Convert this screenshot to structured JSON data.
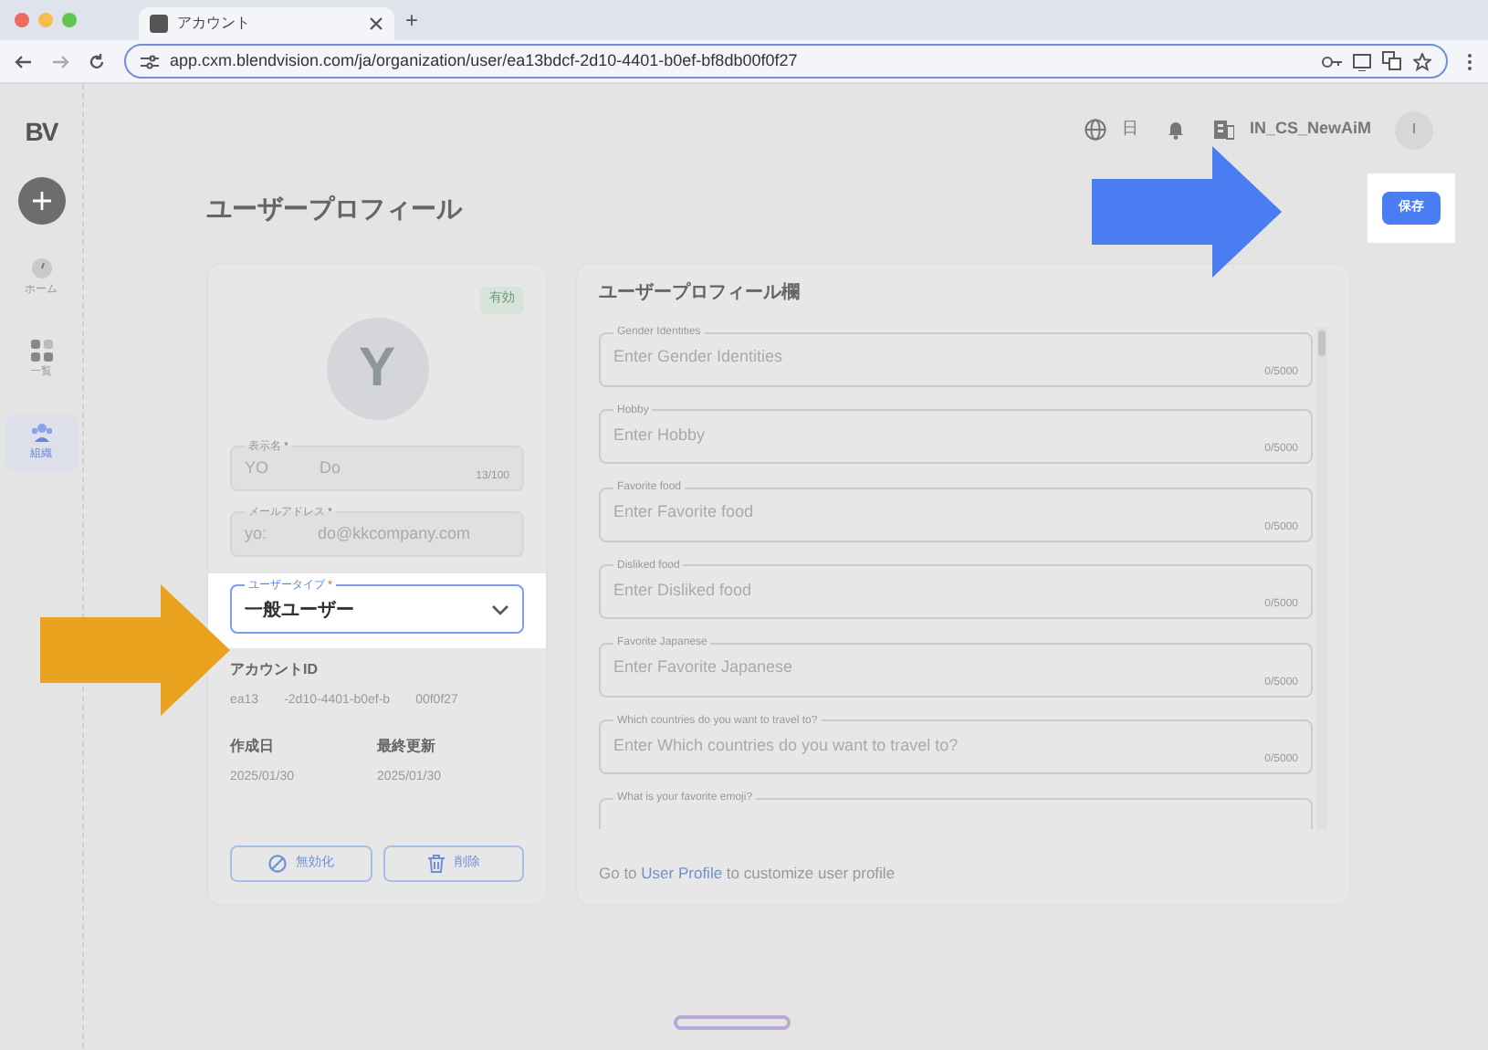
{
  "browser": {
    "tab_title": "アカウント",
    "new_tab": "+",
    "url": "app.cxm.blendvision.com/ja/organization/user/ea13bdcf-2d10-4401-b0ef-bf8db00f0f27"
  },
  "sidebar": {
    "logo": "BV",
    "items": [
      {
        "label": "ホーム",
        "kind": "home",
        "selected": false
      },
      {
        "label": "一覧",
        "kind": "grid",
        "selected": false
      },
      {
        "label": "組織",
        "kind": "people",
        "selected": true
      }
    ]
  },
  "header": {
    "language": "日",
    "organization": "IN_CS_NewAiM",
    "avatar": "I"
  },
  "page": {
    "title": "ユーザープロフィール",
    "save_button": "保存"
  },
  "profile_card": {
    "status": "有効",
    "avatar": "Y",
    "fields": [
      {
        "label": "表示名",
        "required_mark": "*",
        "value": [
          "YO",
          "Do"
        ],
        "counter": "13/100",
        "disabled": true
      },
      {
        "label": "メールアドレス",
        "required_mark": "*",
        "value": [
          "yo:",
          "do@kkcompany.com"
        ],
        "disabled": true
      }
    ],
    "user_type": {
      "label": "ユーザータイプ",
      "required_mark": "*",
      "value": "一般ユーザー"
    },
    "account_id": {
      "label": "アカウントID",
      "value": [
        "ea13",
        "-2d10-4401-b0ef-b",
        "00f0f27"
      ]
    },
    "dates": [
      {
        "label": "作成日",
        "value": "2025/01/30"
      },
      {
        "label": "最終更新",
        "value": "2025/01/30"
      }
    ],
    "buttons": [
      {
        "label": "無効化",
        "kind": "disable"
      },
      {
        "label": "削除",
        "kind": "delete"
      }
    ]
  },
  "profile_fields_card": {
    "title": "ユーザープロフィール欄",
    "fields": [
      {
        "label": "Gender Identities",
        "placeholder": "Enter Gender Identities",
        "counter": "0/5000"
      },
      {
        "label": "Hobby",
        "placeholder": "Enter Hobby",
        "counter": "0/5000"
      },
      {
        "label": "Favorite food",
        "placeholder": "Enter Favorite food",
        "counter": "0/5000"
      },
      {
        "label": "Disliked food",
        "placeholder": "Enter Disliked food",
        "counter": "0/5000"
      },
      {
        "label": "Favorite Japanese",
        "placeholder": "Enter Favorite Japanese",
        "counter": "0/5000"
      },
      {
        "label": "Which countries do you want to travel to?",
        "placeholder": "Enter Which countries do you want to travel to?",
        "counter": "0/5000"
      },
      {
        "label": "What is your favorite emoji?"
      }
    ],
    "footer": {
      "before": "Go to",
      "link": "User Profile",
      "after": "to customize user profile"
    }
  },
  "annotations": [
    {
      "kind": "arrow",
      "color": "#e8a21e"
    },
    {
      "kind": "arrow",
      "color": "#4a7df2"
    }
  ]
}
